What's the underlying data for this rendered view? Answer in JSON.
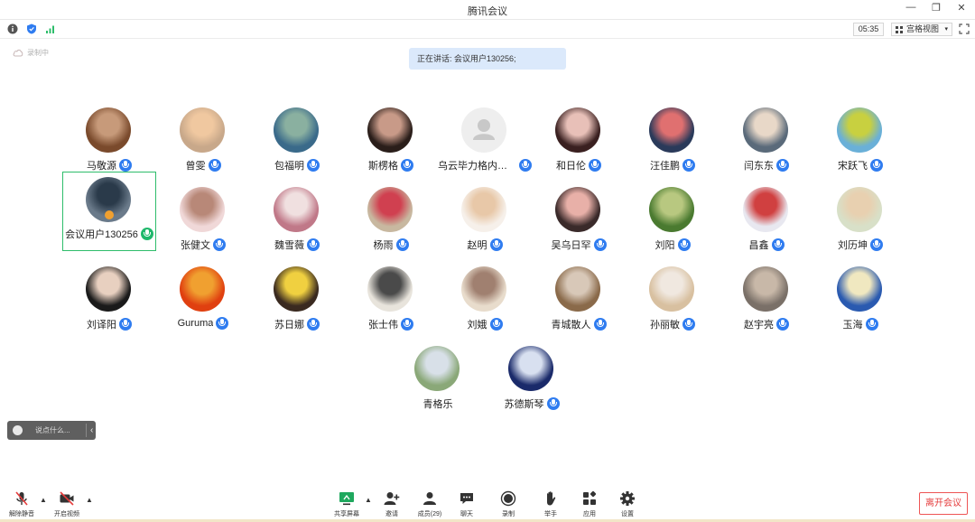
{
  "window": {
    "title": "腾讯会议"
  },
  "toolbar": {
    "time": "05:35",
    "view_mode": "宫格视图"
  },
  "status": {
    "recording": "录制中"
  },
  "speaking": {
    "text": "正在讲话: 会议用户130256;"
  },
  "participants": [
    {
      "name": "马敬源",
      "av": "#7a4a2c",
      "av2": "#c79a7a"
    },
    {
      "name": "曾雯",
      "av": "#c8a88a",
      "av2": "#f0c8a0"
    },
    {
      "name": "包福明",
      "av": "#3a6a8a",
      "av2": "#8ab0a0"
    },
    {
      "name": "斯楞格",
      "av": "#2a1e1a",
      "av2": "#c89a88"
    },
    {
      "name": "乌云毕力格内蒙古...",
      "av": "#e0e0e0",
      "av2": "#f2f2f2"
    },
    {
      "name": "和日伦",
      "av": "#3a2020",
      "av2": "#e8c0b8"
    },
    {
      "name": "汪佳鹏",
      "av": "#2a3a5a",
      "av2": "#e07070"
    },
    {
      "name": "闫东东",
      "av": "#5a6a7a",
      "av2": "#e8d8c8"
    },
    {
      "name": "宋跃飞",
      "av": "#6ab0d8",
      "av2": "#c8d040"
    },
    {
      "name": "会议用户130256",
      "av": "#6a7a8a",
      "av2": "#2a3a4a"
    },
    {
      "name": "张健文",
      "av": "#f0d8d8",
      "av2": "#b88878"
    },
    {
      "name": "魏雪薇",
      "av": "#c07888",
      "av2": "#f0e0e0"
    },
    {
      "name": "杨雨",
      "av": "#c8b8a0",
      "av2": "#d04050"
    },
    {
      "name": "赵明",
      "av": "#f6f0ea",
      "av2": "#e8c8a8"
    },
    {
      "name": "吴乌日罕",
      "av": "#3a2a2a",
      "av2": "#e8b0a8"
    },
    {
      "name": "刘阳",
      "av": "#4a7a30",
      "av2": "#b8c880"
    },
    {
      "name": "昌鑫",
      "av": "#e8e8f0",
      "av2": "#d04040"
    },
    {
      "name": "刘历坤",
      "av": "#d8e0c8",
      "av2": "#e8d0b0"
    },
    {
      "name": "刘译阳",
      "av": "#1a1a1a",
      "av2": "#e8d0c0"
    },
    {
      "name": "Guruma",
      "av": "#e04010",
      "av2": "#f0a030"
    },
    {
      "name": "苏日娜",
      "av": "#3a2a20",
      "av2": "#f0d040"
    },
    {
      "name": "张士伟",
      "av": "#e8e4dc",
      "av2": "#4a4a4a"
    },
    {
      "name": "刘娥",
      "av": "#e8dccc",
      "av2": "#a08070"
    },
    {
      "name": "青城散人",
      "av": "#8a6a4a",
      "av2": "#d8c8b8"
    },
    {
      "name": "孙丽敏",
      "av": "#d8c0a0",
      "av2": "#f0e8e0"
    },
    {
      "name": "赵宇亮",
      "av": "#7a7068",
      "av2": "#c8b8a8"
    },
    {
      "name": "玉海",
      "av": "#2a5ab0",
      "av2": "#f0e8c0"
    },
    {
      "name": "青格乐",
      "av": "#8aa878",
      "av2": "#d8e0e8"
    },
    {
      "name": "苏德斯琴",
      "av": "#1a2a6a",
      "av2": "#d8e0f0"
    }
  ],
  "chat": {
    "placeholder": "说点什么..."
  },
  "bottom": {
    "unmute": "解除静音",
    "start_video": "开启视频",
    "share_screen": "共享屏幕",
    "invite": "邀请",
    "members": "成员(29)",
    "chat": "聊天",
    "record": "录制",
    "raise_hand": "举手",
    "apps": "应用",
    "settings": "设置",
    "leave": "离开会议"
  },
  "colors": {
    "accent": "#2f7cf0",
    "active_border": "#2ebd6b",
    "leave_red": "#e53c3c",
    "banner": "#dbe9fb"
  }
}
